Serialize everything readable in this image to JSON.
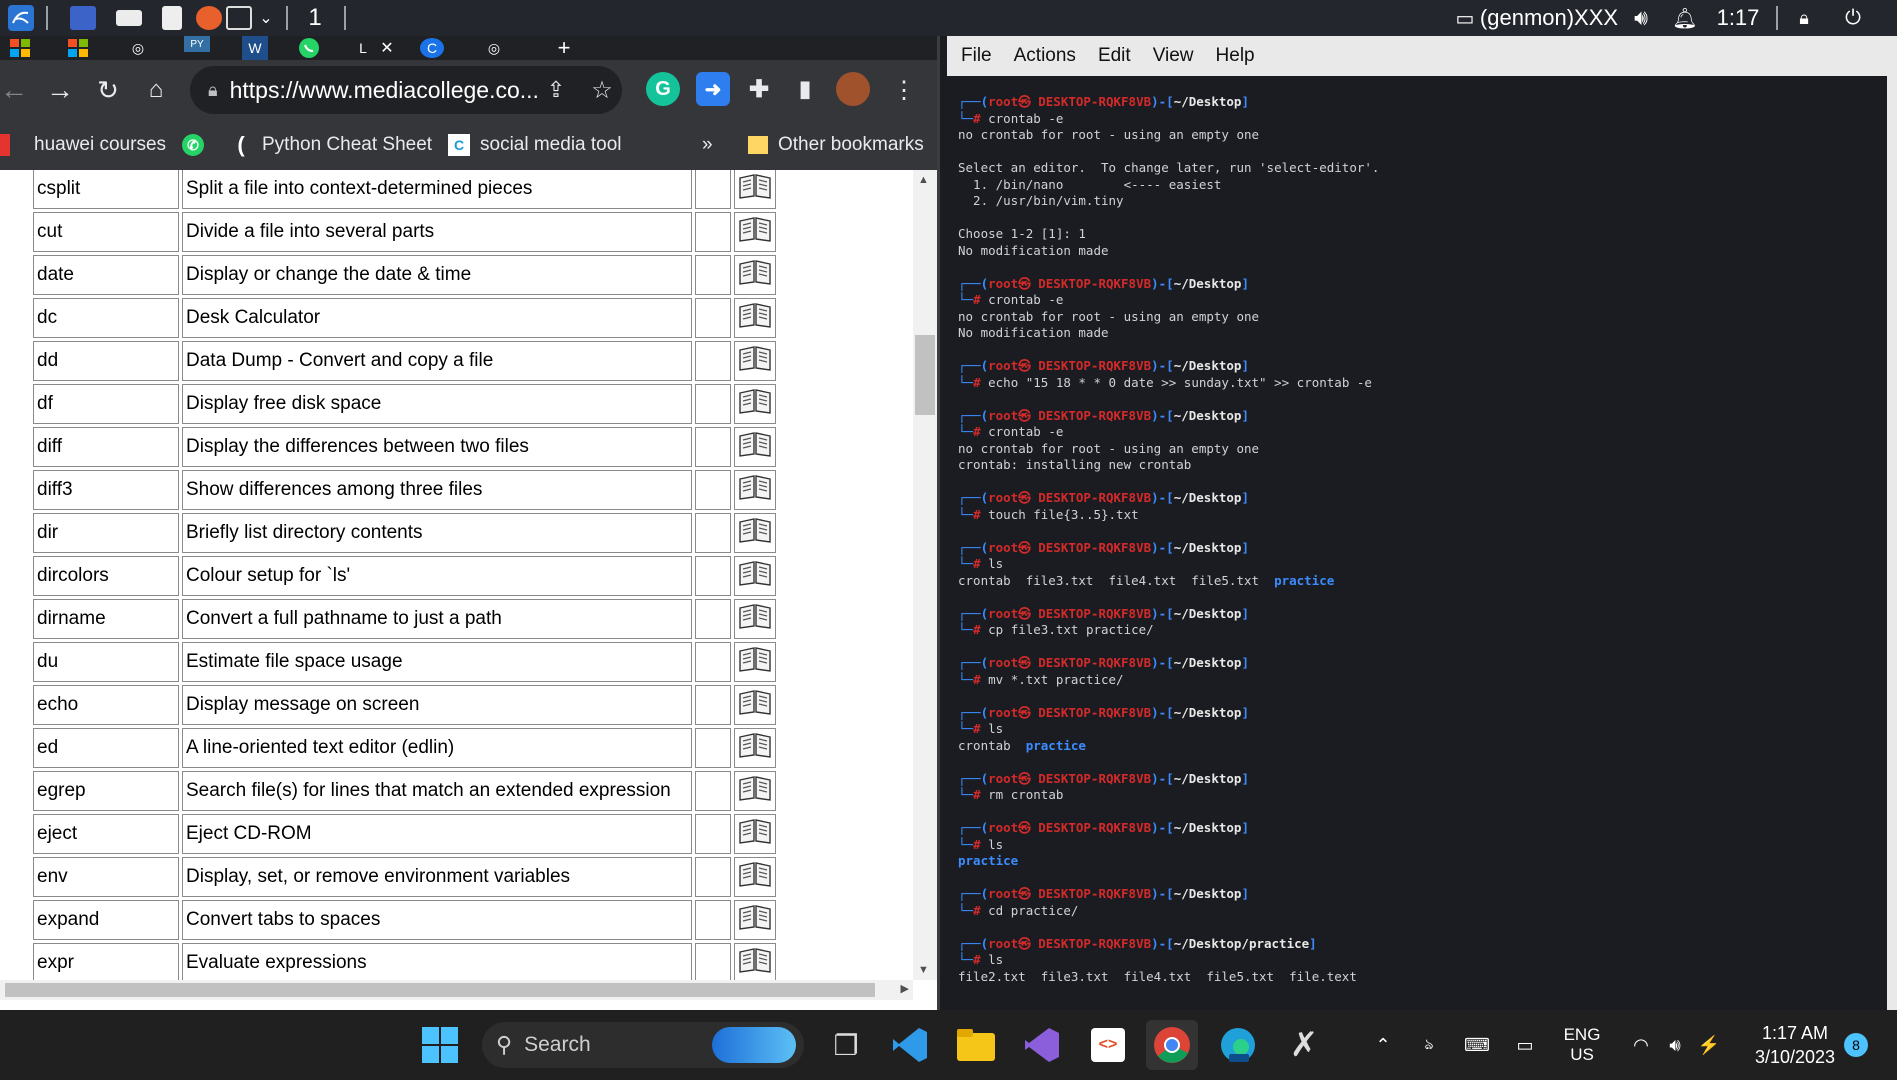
{
  "xpanel": {
    "workspace": "1",
    "genmon": "(genmon)XXX",
    "time": "1:17"
  },
  "chrome": {
    "tab_title_fragment": "L",
    "url_host": "https://www.mediacollege.co...",
    "bookmarks": [
      {
        "label": "huawei courses"
      },
      {
        "label": "Python Cheat Sheet"
      },
      {
        "label": "social media tool"
      },
      {
        "label": "»"
      },
      {
        "label": "Other bookmarks"
      }
    ],
    "commands": [
      {
        "cmd": "csplit",
        "desc": "Split a file into context-determined pieces"
      },
      {
        "cmd": "cut",
        "desc": "Divide a file into several parts"
      },
      {
        "cmd": "date",
        "desc": "Display or change the date & time"
      },
      {
        "cmd": "dc",
        "desc": "Desk Calculator"
      },
      {
        "cmd": "dd",
        "desc": "Data Dump - Convert and copy a file"
      },
      {
        "cmd": "df",
        "desc": "Display free disk space"
      },
      {
        "cmd": "diff",
        "desc": "Display the differences between two files"
      },
      {
        "cmd": "diff3",
        "desc": "Show differences among three files"
      },
      {
        "cmd": "dir",
        "desc": "Briefly list directory contents"
      },
      {
        "cmd": "dircolors",
        "desc": "Colour setup for `ls'"
      },
      {
        "cmd": "dirname",
        "desc": "Convert a full pathname to just a path"
      },
      {
        "cmd": "du",
        "desc": "Estimate file space usage"
      },
      {
        "cmd": "echo",
        "desc": "Display message on screen"
      },
      {
        "cmd": "ed",
        "desc": "A line-oriented text editor (edlin)"
      },
      {
        "cmd": "egrep",
        "desc": "Search file(s) for lines that match an extended expression"
      },
      {
        "cmd": "eject",
        "desc": "Eject CD-ROM"
      },
      {
        "cmd": "env",
        "desc": "Display, set, or remove environment variables"
      },
      {
        "cmd": "expand",
        "desc": "Convert tabs to spaces"
      },
      {
        "cmd": "expr",
        "desc": "Evaluate expressions"
      }
    ]
  },
  "terminal": {
    "menu": [
      "File",
      "Actions",
      "Edit",
      "View",
      "Help"
    ],
    "prompt_user": "root㉿ DESKTOP-RQKF8VB",
    "lines": [
      {
        "t": "prompt",
        "dir": "~/Desktop"
      },
      {
        "t": "cmd",
        "text": "crontab -e"
      },
      {
        "t": "out",
        "text": "no crontab for root - using an empty one"
      },
      {
        "t": "blank"
      },
      {
        "t": "out",
        "text": "Select an editor.  To change later, run 'select-editor'."
      },
      {
        "t": "out",
        "text": "  1. /bin/nano        <---- easiest"
      },
      {
        "t": "out",
        "text": "  2. /usr/bin/vim.tiny"
      },
      {
        "t": "blank"
      },
      {
        "t": "out",
        "text": "Choose 1-2 [1]: 1"
      },
      {
        "t": "out",
        "text": "No modification made"
      },
      {
        "t": "blank"
      },
      {
        "t": "prompt",
        "dir": "~/Desktop"
      },
      {
        "t": "cmd",
        "text": "crontab -e"
      },
      {
        "t": "out",
        "text": "no crontab for root - using an empty one"
      },
      {
        "t": "out",
        "text": "No modification made"
      },
      {
        "t": "blank"
      },
      {
        "t": "prompt",
        "dir": "~/Desktop"
      },
      {
        "t": "cmd",
        "text": "echo \"15 18 * * 0 date >> sunday.txt\" >> crontab -e"
      },
      {
        "t": "blank"
      },
      {
        "t": "prompt",
        "dir": "~/Desktop"
      },
      {
        "t": "cmd",
        "text": "crontab -e"
      },
      {
        "t": "out",
        "text": "no crontab for root - using an empty one"
      },
      {
        "t": "out",
        "text": "crontab: installing new crontab"
      },
      {
        "t": "blank"
      },
      {
        "t": "prompt",
        "dir": "~/Desktop"
      },
      {
        "t": "cmd",
        "text": "touch file{3..5}.txt"
      },
      {
        "t": "blank"
      },
      {
        "t": "prompt",
        "dir": "~/Desktop"
      },
      {
        "t": "cmd",
        "text": "ls"
      },
      {
        "t": "ls",
        "text": "crontab  file3.txt  file4.txt  file5.txt  ",
        "dir": "practice"
      },
      {
        "t": "blank"
      },
      {
        "t": "prompt",
        "dir": "~/Desktop"
      },
      {
        "t": "cmd",
        "text": "cp file3.txt practice/"
      },
      {
        "t": "blank"
      },
      {
        "t": "prompt",
        "dir": "~/Desktop"
      },
      {
        "t": "cmd",
        "text": "mv *.txt practice/"
      },
      {
        "t": "blank"
      },
      {
        "t": "prompt",
        "dir": "~/Desktop"
      },
      {
        "t": "cmd",
        "text": "ls"
      },
      {
        "t": "ls",
        "text": "crontab  ",
        "dir": "practice"
      },
      {
        "t": "blank"
      },
      {
        "t": "prompt",
        "dir": "~/Desktop"
      },
      {
        "t": "cmd",
        "text": "rm crontab"
      },
      {
        "t": "blank"
      },
      {
        "t": "prompt",
        "dir": "~/Desktop"
      },
      {
        "t": "cmd",
        "text": "ls"
      },
      {
        "t": "ls",
        "text": "",
        "dir": "practice"
      },
      {
        "t": "blank"
      },
      {
        "t": "prompt",
        "dir": "~/Desktop"
      },
      {
        "t": "cmd",
        "text": "cd practice/"
      },
      {
        "t": "blank"
      },
      {
        "t": "prompt",
        "dir": "~/Desktop/practice"
      },
      {
        "t": "cmd",
        "text": "ls"
      },
      {
        "t": "out",
        "text": "file2.txt  file3.txt  file4.txt  file5.txt  file.text"
      }
    ]
  },
  "taskbar": {
    "search_label": "Search",
    "lang_top": "ENG",
    "lang_bottom": "US",
    "clock_time": "1:17 AM",
    "clock_date": "3/10/2023",
    "notification_count": "8"
  }
}
